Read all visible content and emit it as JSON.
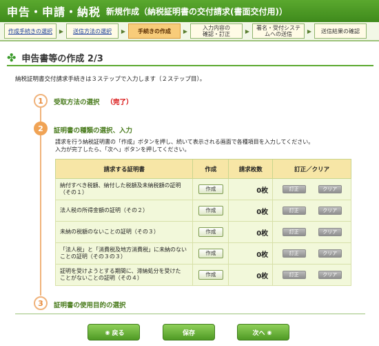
{
  "header": {
    "title": "申告・申請・納税",
    "subtitle": "新規作成（納税証明書の交付請求(書面交付用)）"
  },
  "steps": [
    {
      "label": "作成手続きの選択",
      "state": "link"
    },
    {
      "label": "送信方法の選択",
      "state": "link"
    },
    {
      "label": "手続きの作成",
      "state": "current"
    },
    {
      "label": "入力内容の\n確認・訂正",
      "state": "normal"
    },
    {
      "label": "署名・受付システ\nムへの送信",
      "state": "normal"
    },
    {
      "label": "送信結果の確認",
      "state": "normal"
    }
  ],
  "page": {
    "title": "申告書等の作成 2/3",
    "intro": "納税証明書交付請求手続きは３ステップで入力します（２ステップ目）。"
  },
  "flow": {
    "s1": {
      "num": "1",
      "label": "受取方法の選択",
      "status": "（完了）"
    },
    "s2": {
      "num": "2",
      "label": "証明書の種類の選択、入力",
      "desc_line1": "請求を行う納税証明書の「作成」ボタンを押し、続いて表示される画面で各種項目を入力してください。",
      "desc_line2": "入力が完了したら、「次へ」ボタンを押してください。"
    },
    "s3": {
      "num": "3",
      "label": "証明書の使用目的の選択"
    }
  },
  "table": {
    "headers": [
      "請求する証明書",
      "作成",
      "請求枚数",
      "訂正／クリア"
    ],
    "create_label": "作成",
    "fix_label": "訂正",
    "clear_label": "クリア",
    "rows": [
      {
        "name1": "納付すべき税額、納付した税額及未納税額の証明",
        "name2": "（その１）",
        "count": "0枚"
      },
      {
        "name1": "法人税の所得金額の証明（その２）",
        "name2": "",
        "count": "0枚"
      },
      {
        "name1": "未納の税額のないことの証明（その３）",
        "name2": "",
        "count": "0枚"
      },
      {
        "name1": "「法人税」と「消費税及地方消費税」に未納のない",
        "name2": "ことの証明（その３の３）",
        "count": "0枚"
      },
      {
        "name1": "証明を受けようとする期間に、滞納処分を受けた",
        "name2": "ことがないことの証明（その４）",
        "count": "0枚"
      }
    ]
  },
  "footer": {
    "back": "戻る",
    "save": "保存",
    "next": "次へ"
  },
  "colors": {
    "brand_green": "#4f9a24",
    "current_step": "#f8cc7a",
    "done_red": "#d60000",
    "step_orange": "#f0a355"
  }
}
